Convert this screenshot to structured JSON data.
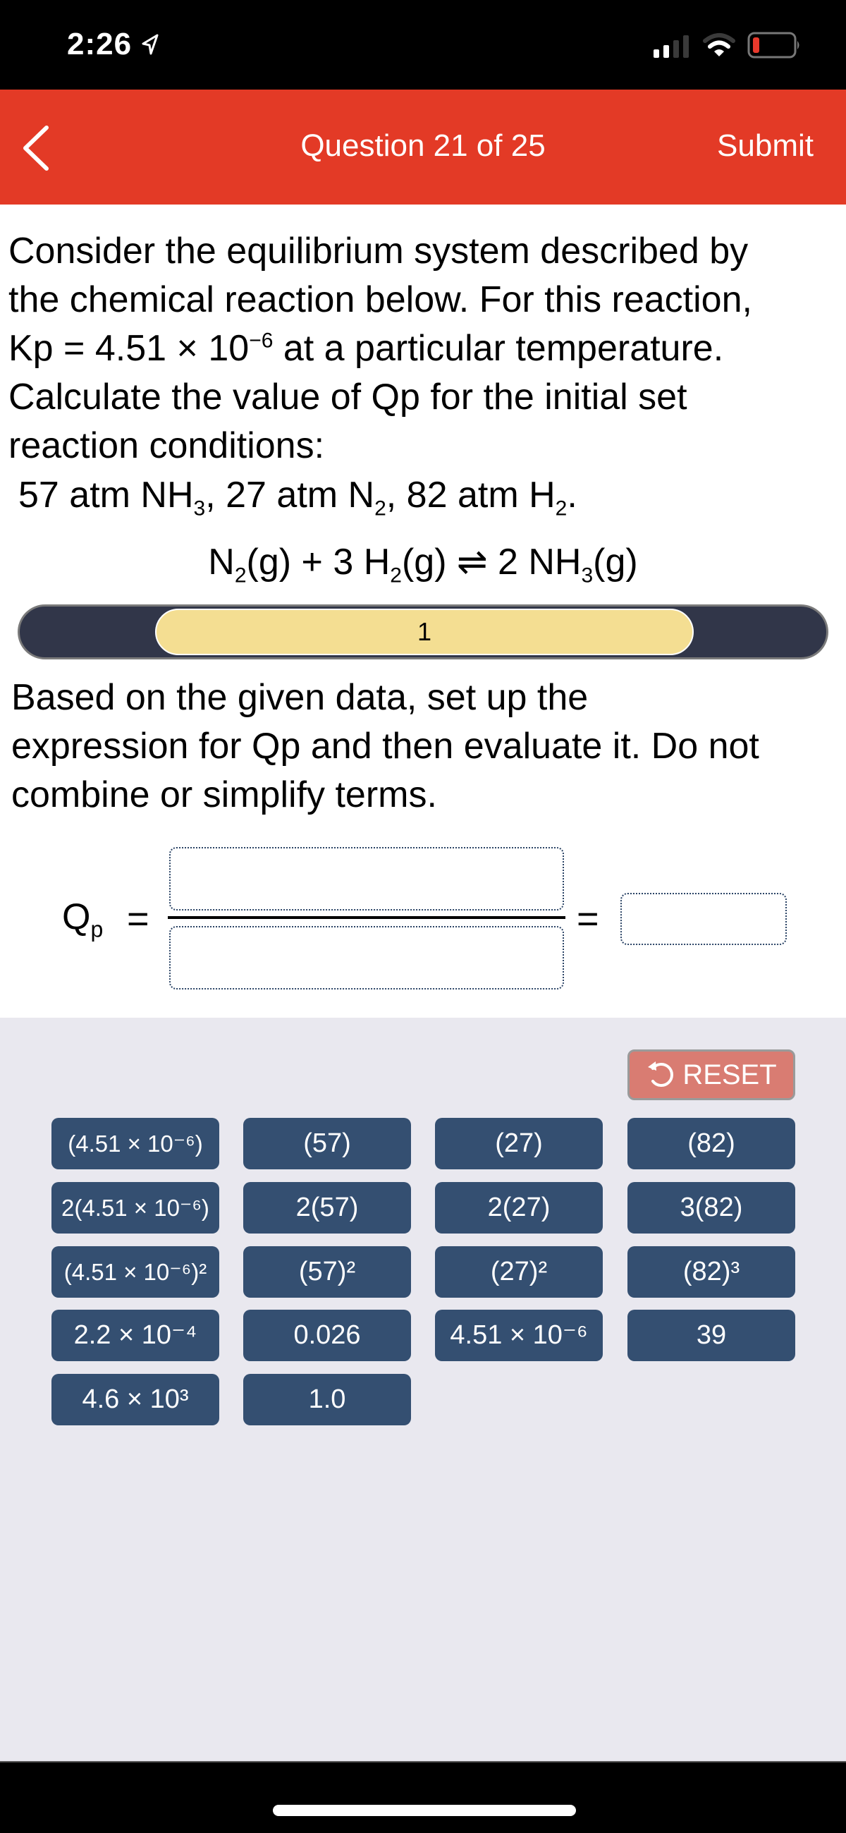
{
  "status_bar": {
    "time": "2:26",
    "icons": [
      "location-arrow-icon",
      "cellular-signal-icon",
      "wifi-icon",
      "battery-low-icon"
    ],
    "battery_color": "#E8392C"
  },
  "header": {
    "back_icon": "chevron-left-icon",
    "title": "Question 21 of 25",
    "submit_label": "Submit",
    "background": "#E33A26"
  },
  "question": {
    "line1": "Consider the equilibrium system described by",
    "line2": "the chemical reaction below. For this reaction,",
    "line3_pre": "Kp = 4.51 × 10",
    "line3_exp": "−6",
    "line3_post": " at a particular temperature.",
    "line4": "Calculate the value of Qp for the initial set",
    "line5": "reaction conditions:",
    "conditions": {
      "p1": "57 atm NH",
      "s1": "3",
      "p2": ", 27 atm N",
      "s2": "2",
      "p3": ", 82 atm H",
      "s3": "2",
      "p4": "."
    },
    "reaction": {
      "r1": "N",
      "r1s": "2",
      "r2": "(g) + 3 H",
      "r2s": "2",
      "r3": "(g) ⇌ 2 NH",
      "r3s": "3",
      "r4": "(g)"
    }
  },
  "progress": {
    "step_label": "1",
    "colors": {
      "track": "#313649",
      "active": "#F4DE92"
    }
  },
  "instructions": {
    "line1": "Based on the given data, set up the",
    "line2": "expression for Qp and then evaluate it. Do not",
    "line3": "combine or simplify terms."
  },
  "equation": {
    "lhs": "Q",
    "lhs_sub": "p",
    "equals": "=",
    "numerator_value": "",
    "denominator_value": "",
    "answer_value": ""
  },
  "tray": {
    "reset_label": "RESET",
    "reset_icon": "undo-icon",
    "tiles": [
      {
        "label": "(4.51 × 10⁻⁶)"
      },
      {
        "label": "(57)"
      },
      {
        "label": "(27)"
      },
      {
        "label": "(82)"
      },
      {
        "label": "2(4.51 × 10⁻⁶)"
      },
      {
        "label": "2(57)"
      },
      {
        "label": "2(27)"
      },
      {
        "label": "3(82)"
      },
      {
        "label": "(4.51 × 10⁻⁶)²"
      },
      {
        "label": "(57)²"
      },
      {
        "label": "(27)²"
      },
      {
        "label": "(82)³"
      },
      {
        "label": "2.2 × 10⁻⁴"
      },
      {
        "label": "0.026"
      },
      {
        "label": "4.51 × 10⁻⁶"
      },
      {
        "label": "39"
      },
      {
        "label": "4.6 × 10³"
      },
      {
        "label": "1.0"
      }
    ]
  }
}
